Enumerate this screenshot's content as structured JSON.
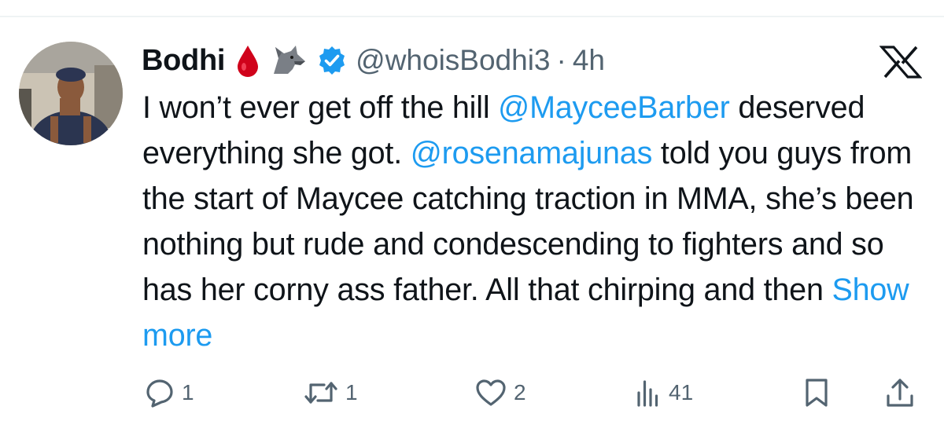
{
  "tweet": {
    "author_name": "Bodhi",
    "handle": "@whoisBodhi3",
    "separator": "·",
    "time": "4h",
    "text_segments": [
      {
        "type": "text",
        "value": "I won’t ever get off the hill "
      },
      {
        "type": "mention",
        "value": "@MayceeBarber"
      },
      {
        "type": "text",
        "value": " deserved everything she got. "
      },
      {
        "type": "mention",
        "value": "@rosenamajunas"
      },
      {
        "type": "text",
        "value": " told you guys from the start of Maycee catching traction in MMA, she’s been nothing but rude and condescending to fighters and so has her corny ass father. All that chirping and then "
      },
      {
        "type": "link",
        "value": "Show more"
      }
    ]
  },
  "actions": {
    "replies": "1",
    "reposts": "1",
    "likes": "2",
    "views": "41"
  },
  "icons": {
    "name_emojis": [
      "blood-drop-icon",
      "wolf-icon"
    ],
    "verified": "verified-badge-icon",
    "platform_logo": "x-logo-icon",
    "action_icons": [
      "reply-icon",
      "repost-icon",
      "like-icon",
      "views-icon",
      "bookmark-icon",
      "share-icon"
    ]
  },
  "colors": {
    "text": "#0f1419",
    "muted": "#536471",
    "accent": "#1d9bf0",
    "blood": "#d0021b"
  }
}
